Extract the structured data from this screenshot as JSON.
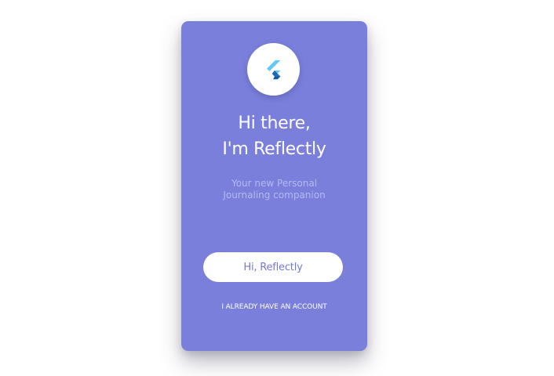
{
  "colors": {
    "card_background": "#7a7fdc",
    "button_background": "#ffffff",
    "button_text": "#7479d6",
    "subtitle_text": "#b6baf0",
    "logo_light_blue": "#5fc9f8",
    "logo_dark_blue": "#0d5aa7"
  },
  "logo": {
    "icon": "flutter-logo-icon"
  },
  "headline": {
    "line1": "Hi there,",
    "line2": "I'm Reflectly"
  },
  "subtitle": {
    "line1": "Your new Personal",
    "line2": "Journaling companion"
  },
  "primary_button": {
    "label": "Hi, Reflectly"
  },
  "secondary_link": {
    "label": "I ALREADY HAVE AN ACCOUNT"
  }
}
